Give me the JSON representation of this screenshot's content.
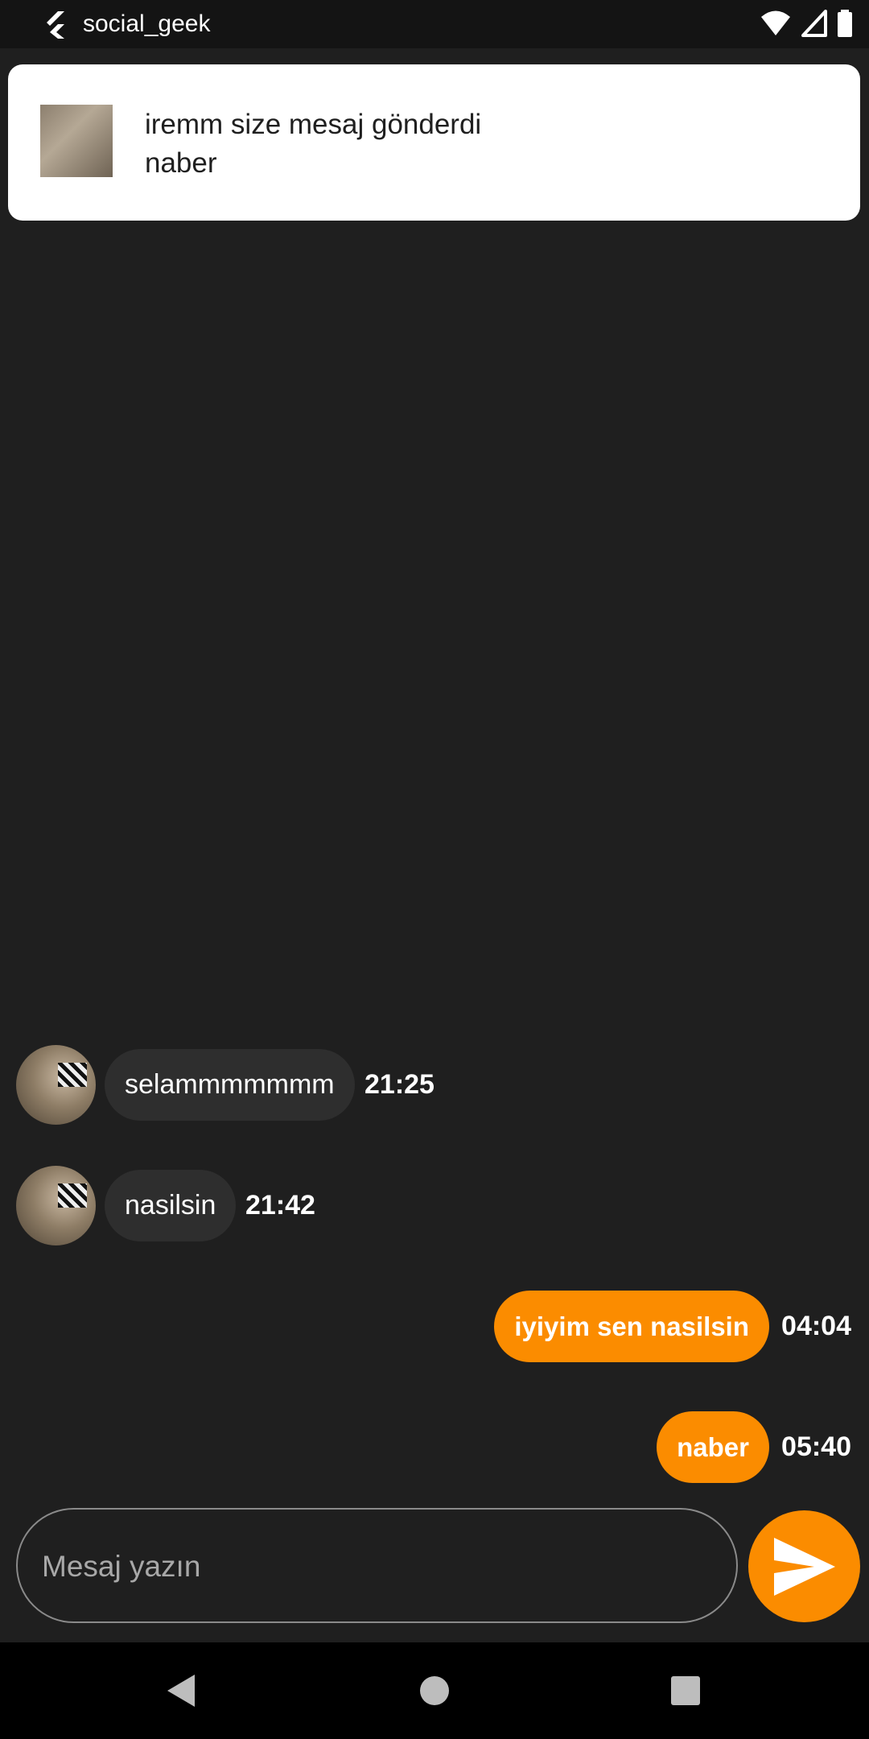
{
  "status_bar": {
    "app_name": "social_geek",
    "icons": [
      "flutter-logo-icon",
      "wifi-icon",
      "signal-icon",
      "battery-icon"
    ]
  },
  "notification": {
    "title": "iremm size mesaj gönderdi",
    "body": "naber"
  },
  "messages": [
    {
      "direction": "incoming",
      "text": "selammmmmmm",
      "time": "21:25"
    },
    {
      "direction": "incoming",
      "text": "nasilsin",
      "time": "21:42"
    },
    {
      "direction": "outgoing",
      "text": "iyiyim sen nasilsin",
      "time": "04:04"
    },
    {
      "direction": "outgoing",
      "text": "naber",
      "time": "05:40"
    }
  ],
  "composer": {
    "placeholder": "Mesaj yazın",
    "send_icon": "send-icon"
  },
  "nav_bar": {
    "icons": [
      "back-icon",
      "home-icon",
      "recents-icon"
    ]
  },
  "colors": {
    "background": "#1f1f1f",
    "accent": "#fb8c00",
    "incoming_bubble": "#2e2e2e"
  }
}
